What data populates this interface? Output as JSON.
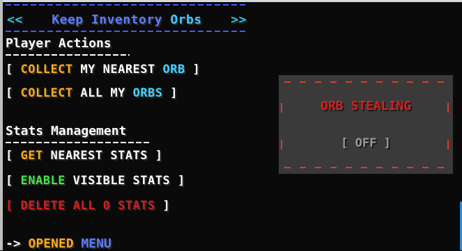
{
  "menu": {
    "title_arrow_left": "<<",
    "title_prefix": "Keep Inventory ",
    "title_orbs": "Orbs",
    "title_arrow_right": ">>"
  },
  "player_actions": {
    "heading": "Player Actions",
    "collect_nearest": {
      "open": "[",
      "verb": "COLLECT",
      "mid": "MY NEAREST",
      "noun": "ORB",
      "close": "]"
    },
    "collect_all": {
      "open": "[",
      "verb": "COLLECT",
      "mid": "ALL MY",
      "noun": "ORBS",
      "close": "]"
    }
  },
  "stats_management": {
    "heading": "Stats Management",
    "get_nearest": {
      "open": "[",
      "verb": "GET",
      "rest": "NEAREST STATS",
      "close": "]"
    },
    "enable_visible": {
      "open": "[",
      "verb": "ENABLE",
      "rest": "VISIBLE STATS",
      "close": "]"
    },
    "delete_all": {
      "open": "[",
      "verb": "DELETE",
      "rest": "ALL 0 STATS",
      "close": "]"
    }
  },
  "orb_stealing": {
    "title_orb": "ORB",
    "title_rest": "STEALING",
    "status": "[ OFF ]"
  },
  "footer": {
    "arrow": "->",
    "opened": "OPENED",
    "menu": "MENU"
  },
  "colors": {
    "accent_orange": "#ffaa1e",
    "accent_cyan": "#45d4ff",
    "accent_green": "#44e34a",
    "accent_red": "#d41e1e",
    "accent_blue": "#5c7cff"
  }
}
